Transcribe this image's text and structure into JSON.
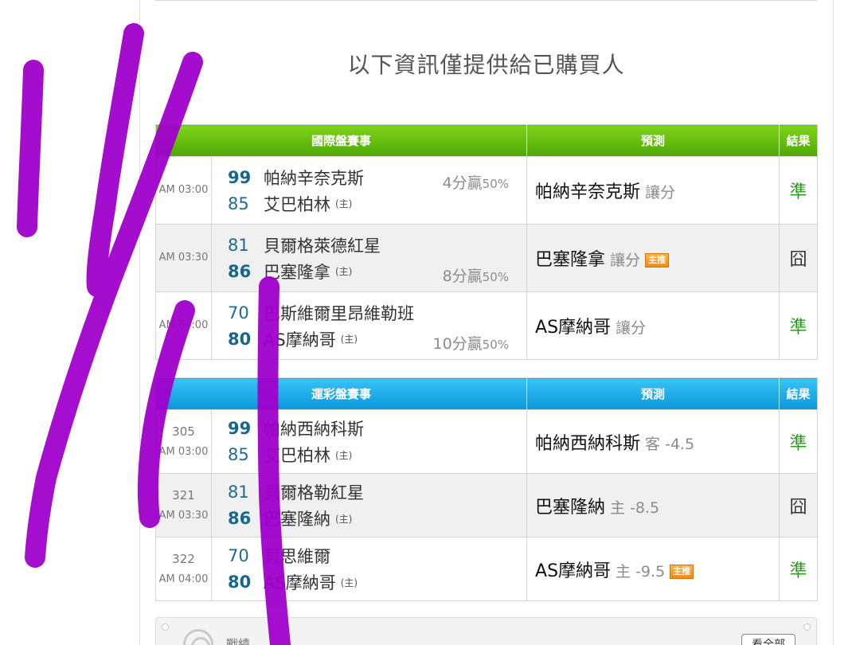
{
  "notice": "以下資訊僅提供給已購買人",
  "home_tag": "(主)",
  "badge_label": "主推",
  "international": {
    "headers": {
      "game": "國際盤賽事",
      "prediction": "預測",
      "result": "結果"
    },
    "games": [
      {
        "time": "AM 03:00",
        "code": "",
        "away": {
          "score": "99",
          "name": "帕納辛奈克斯",
          "winner": true
        },
        "home": {
          "score": "85",
          "name": "艾巴柏林",
          "winner": false
        },
        "spread": {
          "points": "4分贏",
          "pct": "50%",
          "row": "away"
        },
        "prediction": {
          "team": "帕納辛奈克斯",
          "kind": "讓分",
          "featured": false
        },
        "result": "準",
        "result_type": "hit"
      },
      {
        "time": "AM 03:30",
        "code": "",
        "away": {
          "score": "81",
          "name": "貝爾格萊德紅星",
          "winner": false
        },
        "home": {
          "score": "86",
          "name": "巴塞隆拿",
          "winner": true
        },
        "spread": {
          "points": "8分贏",
          "pct": "50%",
          "row": "home"
        },
        "prediction": {
          "team": "巴塞隆拿",
          "kind": "讓分",
          "featured": true
        },
        "result": "囧",
        "result_type": "miss"
      },
      {
        "time": "AM 04:00",
        "code": "",
        "away": {
          "score": "70",
          "name": "巴斯維爾里昂維勒班",
          "winner": false
        },
        "home": {
          "score": "80",
          "name": "AS摩納哥",
          "winner": true
        },
        "spread": {
          "points": "10分贏",
          "pct": "50%",
          "row": "home"
        },
        "prediction": {
          "team": "AS摩納哥",
          "kind": "讓分",
          "featured": false
        },
        "result": "準",
        "result_type": "hit"
      }
    ]
  },
  "lottery": {
    "headers": {
      "game": "運彩盤賽事",
      "prediction": "預測",
      "result": "結果"
    },
    "games": [
      {
        "time": "AM 03:00",
        "code": "305",
        "away": {
          "score": "99",
          "name": "帕納西納科斯",
          "winner": true
        },
        "home": {
          "score": "85",
          "name": "艾巴柏林",
          "winner": false
        },
        "prediction": {
          "team": "帕納西納科斯",
          "kind": "客 -4.5",
          "featured": false
        },
        "result": "準",
        "result_type": "hit"
      },
      {
        "time": "AM 03:30",
        "code": "321",
        "away": {
          "score": "81",
          "name": "貝爾格勒紅星",
          "winner": false
        },
        "home": {
          "score": "86",
          "name": "巴塞隆納",
          "winner": true
        },
        "prediction": {
          "team": "巴塞隆納",
          "kind": "主 -8.5",
          "featured": false
        },
        "result": "囧",
        "result_type": "miss"
      },
      {
        "time": "AM 04:00",
        "code": "322",
        "away": {
          "score": "70",
          "name": "貝思維爾",
          "winner": false
        },
        "home": {
          "score": "80",
          "name": "AS摩納哥",
          "winner": true
        },
        "prediction": {
          "team": "AS摩納哥",
          "kind": "主 -9.5",
          "featured": true
        },
        "result": "準",
        "result_type": "hit"
      }
    ]
  },
  "record": {
    "label": "戰績",
    "see_all": "看全部"
  },
  "colors": {
    "intl_header": "#5db40c",
    "lottery_header": "#1aa8e8",
    "score": "#15678c",
    "hit": "#2d9b20",
    "scribble": "#a000cc"
  }
}
